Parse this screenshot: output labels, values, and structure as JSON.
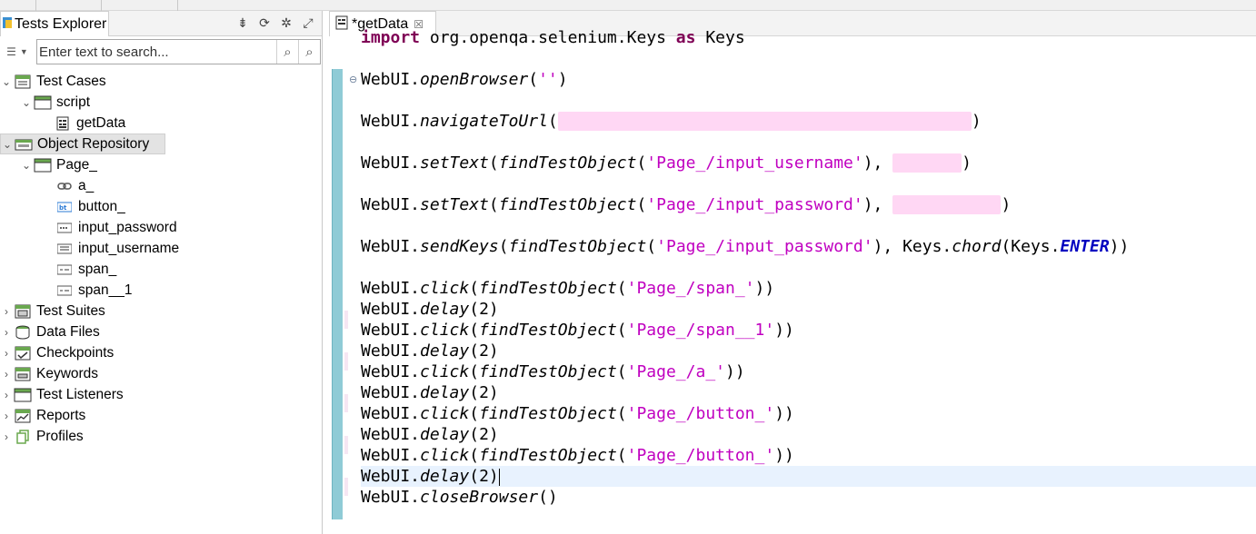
{
  "explorer": {
    "tab_title": "Tests Explorer",
    "search_placeholder": "Enter text to search...",
    "tree": [
      {
        "label": "Test Cases",
        "expanded": true,
        "icon": "test-cases-icon"
      },
      {
        "label": "script",
        "expanded": true,
        "icon": "folder-icon"
      },
      {
        "label": "getData",
        "icon": "test-case-file-icon"
      },
      {
        "label": "Object Repository",
        "expanded": true,
        "icon": "object-repository-icon",
        "selected": true
      },
      {
        "label": "Page_",
        "expanded": true,
        "icon": "folder-icon"
      },
      {
        "label": "a_",
        "icon": "link-object-icon"
      },
      {
        "label": "button_",
        "icon": "button-object-icon"
      },
      {
        "label": "input_password",
        "icon": "input-object-icon"
      },
      {
        "label": "input_username",
        "icon": "input-object-icon"
      },
      {
        "label": "span_",
        "icon": "span-object-icon"
      },
      {
        "label": "span__1",
        "icon": "span-object-icon"
      },
      {
        "label": "Test Suites",
        "icon": "test-suites-icon"
      },
      {
        "label": "Data Files",
        "icon": "data-files-icon"
      },
      {
        "label": "Checkpoints",
        "icon": "checkpoints-icon"
      },
      {
        "label": "Keywords",
        "icon": "keywords-icon"
      },
      {
        "label": "Test Listeners",
        "icon": "test-listeners-icon"
      },
      {
        "label": "Reports",
        "icon": "reports-icon"
      },
      {
        "label": "Profiles",
        "icon": "profiles-icon"
      }
    ]
  },
  "editor": {
    "tab_title": "*getData",
    "code": {
      "import_line": "import org.openqa.selenium.Keys as Keys",
      "open_browser": "WebUI.openBrowser('')",
      "navigate_prefix": "WebUI.navigateToUrl(",
      "set_text_user_obj": "'Page_/input_username'",
      "set_text_pass_obj": "'Page_/input_password'",
      "send_keys_obj": "'Page_/input_password'",
      "span_obj": "'Page_/span_'",
      "span1_obj": "'Page_/span__1'",
      "a_obj": "'Page_/a_'",
      "button_obj": "'Page_/button_'",
      "delay_arg": "2",
      "close_browser": "WebUI.closeBrowser()"
    }
  }
}
